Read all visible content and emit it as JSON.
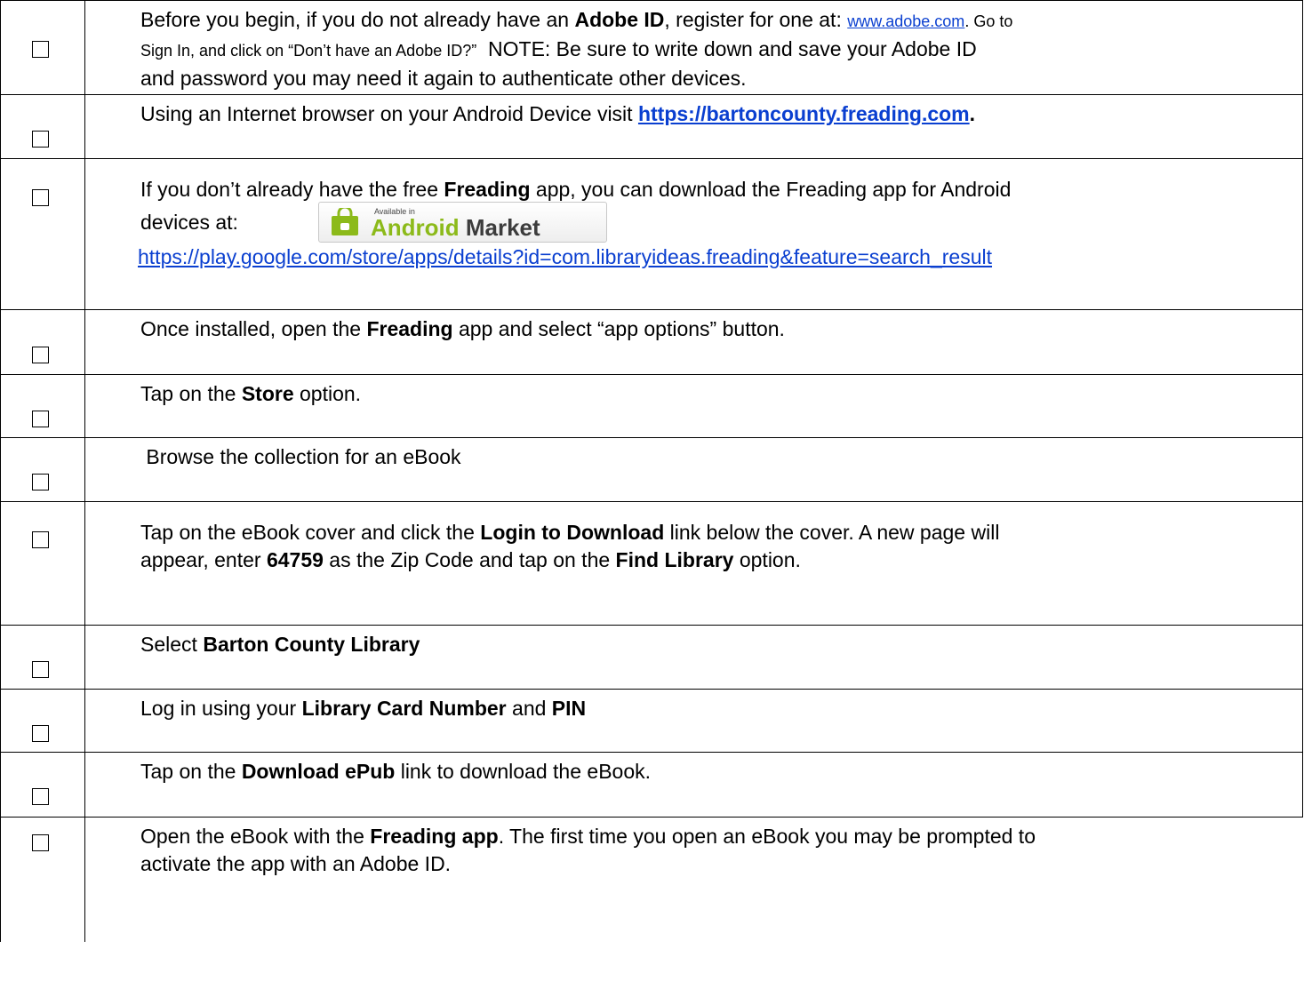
{
  "rows": [
    {
      "adobe_pre": "Before you begin, if you do not already have an ",
      "adobe_bold": "Adobe ID",
      "adobe_mid": ", register for one at: ",
      "adobe_link": "www.adobe.com",
      "adobe_post": ". Go to",
      "line2_small": "Sign In, and click on “Don’t have an Adobe ID?”",
      "line2_rest": "  NOTE: Be sure to write down and save your Adobe ID",
      "line3": "and password you may need it again to authenticate other devices."
    },
    {
      "pre": "Using an Internet browser on your Android Device visit ",
      "link": "https://bartoncounty.freading.com",
      "post": "."
    },
    {
      "pre": "If you don’t already have the free ",
      "bold": "Freading",
      "post": " app, you can download the Freading app for Android",
      "line2": "devices at:",
      "badge_small": "Available in",
      "badge_android": "Android",
      "badge_market": " Market",
      "link": "https://play.google.com/store/apps/details?id=com.libraryideas.freading&feature=search_result"
    },
    {
      "pre": "Once installed, open the ",
      "bold": "Freading",
      "post": " app and select “app options” button."
    },
    {
      "pre": "Tap on the ",
      "bold": "Store",
      "post": " option."
    },
    {
      "text": " Browse the collection for an eBook"
    },
    {
      "pre": "Tap on the eBook cover and click the ",
      "bold": "Login to Download",
      "post": " link below the cover. A new page will",
      "l2_pre": "appear, enter ",
      "l2_bold": "64759",
      "l2_mid": " as the Zip Code and tap on the ",
      "l2_bold2": "Find Library",
      "l2_post": " option."
    },
    {
      "pre": "Select ",
      "bold": "Barton County Library"
    },
    {
      "pre": "Log in using your ",
      "bold": "Library Card Number",
      "mid": " and ",
      "bold2": "PIN"
    },
    {
      "pre": "Tap on the ",
      "bold": "Download ePub",
      "post": " link to download the eBook."
    },
    {
      "pre": "Open the eBook with the ",
      "bold": "Freading app",
      "post": ". The first time you open an eBook you may be prompted to",
      "line2": "activate the app with an Adobe ID."
    }
  ]
}
